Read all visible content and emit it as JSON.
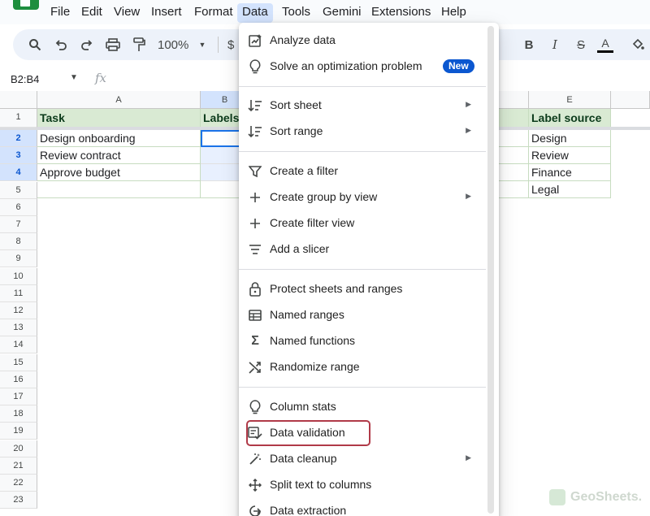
{
  "menubar": {
    "items": [
      {
        "label": "File"
      },
      {
        "label": "Edit"
      },
      {
        "label": "View"
      },
      {
        "label": "Insert"
      },
      {
        "label": "Format"
      },
      {
        "label": "Data"
      },
      {
        "label": "Tools"
      },
      {
        "label": "Gemini"
      },
      {
        "label": "Extensions"
      },
      {
        "label": "Help"
      }
    ],
    "active": "Data"
  },
  "toolbar": {
    "zoom": "100%",
    "currency": "$",
    "icons": [
      "search-icon",
      "undo-icon",
      "redo-icon",
      "print-icon",
      "paint-format-icon",
      "zoom-caret-icon",
      "bold-icon",
      "italic-icon",
      "strikethrough-icon",
      "text-color-icon",
      "fill-color-icon"
    ]
  },
  "formula_bar": {
    "name_box": "B2:B4",
    "fx": "fx"
  },
  "sheet": {
    "columns": [
      "A",
      "B",
      "E"
    ],
    "rows": [
      "1",
      "2",
      "3",
      "4",
      "5",
      "6",
      "7",
      "8",
      "9",
      "10",
      "11",
      "12",
      "13",
      "14",
      "15",
      "16",
      "17",
      "18",
      "19",
      "20",
      "21",
      "22",
      "23"
    ],
    "header_row": {
      "A": "Task",
      "B": "Labels",
      "E": "Label source"
    },
    "col_a": [
      "Design onboarding",
      "Review contract",
      "Approve budget",
      ""
    ],
    "col_e": [
      "Design",
      "Review",
      "Finance",
      "Legal"
    ]
  },
  "data_menu": {
    "groups": [
      [
        {
          "icon": "analyze-data-icon",
          "label": "Analyze data"
        },
        {
          "icon": "lightbulb-icon",
          "label": "Solve an optimization problem",
          "badge": "New"
        }
      ],
      [
        {
          "icon": "sort-icon",
          "label": "Sort sheet",
          "submenu": true
        },
        {
          "icon": "sort-icon",
          "label": "Sort range",
          "submenu": true
        }
      ],
      [
        {
          "icon": "filter-icon",
          "label": "Create a filter"
        },
        {
          "icon": "plus-icon",
          "label": "Create group by view",
          "submenu": true
        },
        {
          "icon": "plus-icon",
          "label": "Create filter view"
        },
        {
          "icon": "slicer-icon",
          "label": "Add a slicer"
        }
      ],
      [
        {
          "icon": "lock-icon",
          "label": "Protect sheets and ranges"
        },
        {
          "icon": "named-ranges-icon",
          "label": "Named ranges"
        },
        {
          "icon": "sigma-icon",
          "label": "Named functions"
        },
        {
          "icon": "shuffle-icon",
          "label": "Randomize range"
        }
      ],
      [
        {
          "icon": "lightbulb-icon",
          "label": "Column stats"
        },
        {
          "icon": "data-validation-icon",
          "label": "Data validation",
          "highlighted": true
        },
        {
          "icon": "magic-wand-icon",
          "label": "Data cleanup",
          "submenu": true
        },
        {
          "icon": "split-icon",
          "label": "Split text to columns"
        },
        {
          "icon": "extraction-icon",
          "label": "Data extraction"
        }
      ]
    ],
    "submenu_arrow": "▶"
  },
  "watermark": "GeoSheets."
}
